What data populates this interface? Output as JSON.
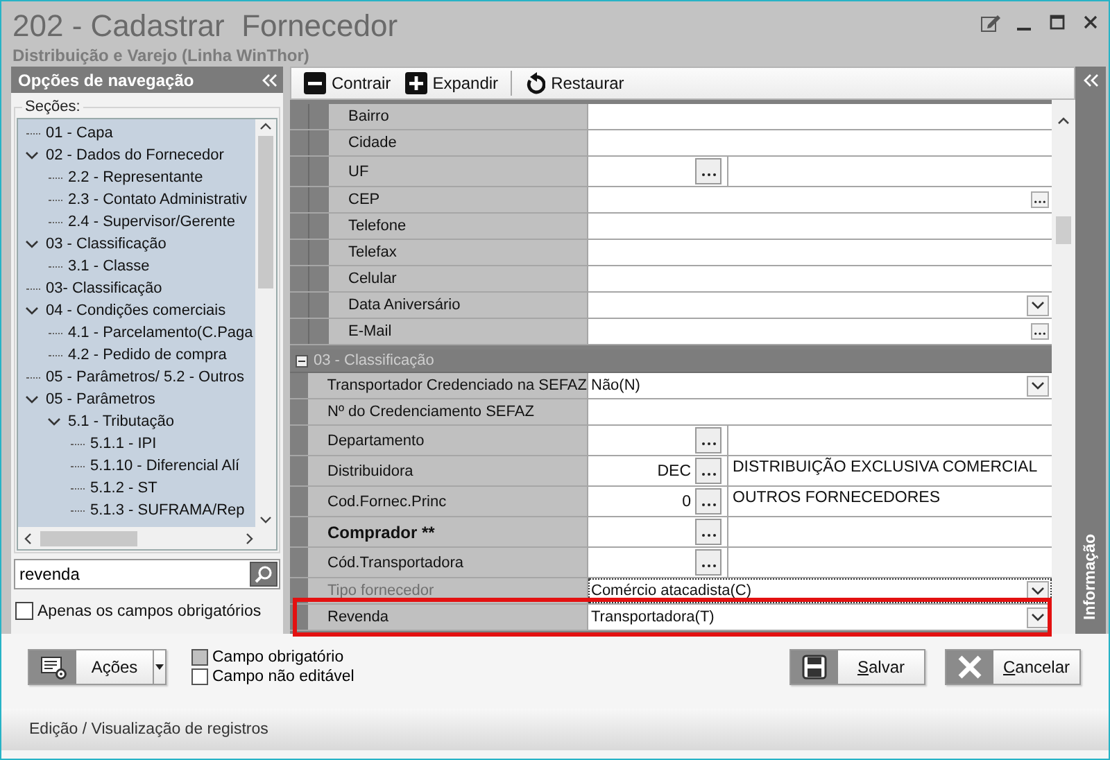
{
  "window": {
    "title": "202 - Cadastrar  Fornecedor",
    "subtitle": "Distribuição e Varejo (Linha WinThor)"
  },
  "navigation": {
    "title": "Opções de navegação",
    "sections_label": "Seções:",
    "tree": [
      {
        "label": "01 - Capa"
      },
      {
        "label": "02 - Dados do Fornecedor",
        "expanded": true,
        "children": [
          {
            "label": "2.2 - Representante"
          },
          {
            "label": "2.3 - Contato Administrativ"
          },
          {
            "label": "2.4 - Supervisor/Gerente"
          }
        ]
      },
      {
        "label": "03 - Classificação",
        "expanded": true,
        "children": [
          {
            "label": "3.1 - Classe"
          }
        ]
      },
      {
        "label": "03- Classificação"
      },
      {
        "label": "04 - Condições comerciais",
        "expanded": true,
        "children": [
          {
            "label": "4.1 - Parcelamento(C.Paga"
          },
          {
            "label": "4.2 - Pedido de compra"
          }
        ]
      },
      {
        "label": "05 - Parâmetros/ 5.2 - Outros"
      },
      {
        "label": "05 - Parâmetros",
        "expanded": true,
        "children": [
          {
            "label": "5.1 - Tributação",
            "expanded": true,
            "children": [
              {
                "label": "5.1.1 - IPI"
              },
              {
                "label": "5.1.10 - Diferencial Alí"
              },
              {
                "label": "5.1.2 - ST"
              },
              {
                "label": "5.1.3 - SUFRAMA/Rep"
              }
            ]
          }
        ]
      }
    ],
    "search": {
      "value": "revenda"
    },
    "required_only": {
      "label": "Apenas os campos obrigatórios",
      "checked": false
    }
  },
  "toolbar": [
    {
      "label": "Contrair",
      "kind": "collapse"
    },
    {
      "label": "Expandir",
      "kind": "expand"
    },
    {
      "label": "Restaurar",
      "kind": "restore"
    }
  ],
  "form": {
    "groups": [
      {
        "rows": [
          {
            "label": "Bairro",
            "kind": "text",
            "required": false,
            "disabled": false,
            "highlighted": false
          },
          {
            "label": "Cidade",
            "kind": "text",
            "required": false,
            "disabled": false,
            "highlighted": false
          },
          {
            "label": "UF",
            "kind": "lookup",
            "required": false,
            "disabled": false,
            "highlighted": false
          },
          {
            "label": "CEP",
            "kind": "browse",
            "required": false,
            "disabled": false,
            "highlighted": false
          },
          {
            "label": "Telefone",
            "kind": "text",
            "required": false,
            "disabled": false,
            "highlighted": false
          },
          {
            "label": "Telefax",
            "kind": "text",
            "required": false,
            "disabled": false,
            "highlighted": false
          },
          {
            "label": "Celular",
            "kind": "text",
            "required": false,
            "disabled": false,
            "highlighted": false
          },
          {
            "label": "Data Aniversário",
            "kind": "dropdown",
            "required": false,
            "disabled": false,
            "highlighted": false
          },
          {
            "label": "E-Mail",
            "kind": "browse",
            "required": false,
            "disabled": false,
            "highlighted": false
          }
        ]
      },
      {
        "title": "03 - Classificação",
        "expanded": true,
        "rows": [
          {
            "label": "Transportador Credenciado na SEFAZ",
            "kind": "dropdown",
            "value": "Não(N)",
            "required": false,
            "disabled": false,
            "highlighted": false
          },
          {
            "label": "Nº do Credenciamento SEFAZ",
            "kind": "text",
            "required": false,
            "disabled": false,
            "highlighted": false
          },
          {
            "label": "Departamento",
            "kind": "lookup",
            "required": false,
            "disabled": false,
            "highlighted": false
          },
          {
            "label": "Distribuidora",
            "kind": "lookup",
            "code": "DEC",
            "description": "DISTRIBUIÇÃO EXCLUSIVA COMERCIAL",
            "required": false,
            "disabled": false,
            "highlighted": false
          },
          {
            "label": "Cod.Fornec.Princ",
            "kind": "lookup",
            "code": "0",
            "description": "OUTROS FORNECEDORES",
            "required": false,
            "disabled": false,
            "highlighted": false
          },
          {
            "label": "Comprador **",
            "kind": "lookup",
            "required": true,
            "disabled": false,
            "highlighted": false
          },
          {
            "label": "Cód.Transportadora",
            "kind": "lookup",
            "required": false,
            "disabled": false,
            "highlighted": false
          },
          {
            "label": "Tipo fornecedor",
            "kind": "dropdown",
            "value": "Comércio atacadista(C)",
            "required": false,
            "disabled": true,
            "highlighted": false
          },
          {
            "label": "Revenda",
            "kind": "dropdown",
            "value": "Transportadora(T)",
            "required": false,
            "disabled": false,
            "highlighted": true
          }
        ]
      }
    ]
  },
  "side_tab": "Informação",
  "actions_button": "Ações",
  "legend": [
    {
      "label": "Campo obrigatório",
      "kind": "required"
    },
    {
      "label": "Campo não editável",
      "kind": "readonly"
    }
  ],
  "buttons": [
    {
      "label": "Salvar",
      "kind": "save"
    },
    {
      "label": "Cancelar",
      "kind": "cancel"
    }
  ],
  "status_bar": "Edição / Visualização de registros"
}
